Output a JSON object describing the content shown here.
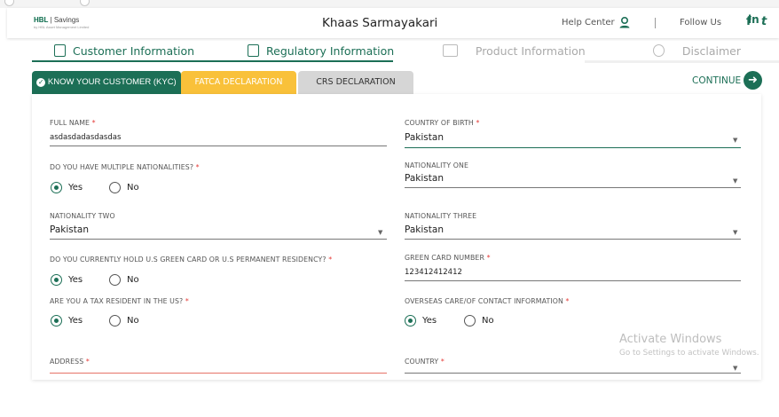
{
  "header": {
    "logo_brand": "HBL",
    "logo_product": "Savings",
    "logo_tagline": "by HBL Asset Management Limited",
    "title": "Khaas Sarmayakari",
    "help_label": "Help Center",
    "follow_label": "Follow Us",
    "social": [
      "f",
      "t",
      "in"
    ]
  },
  "tabs": [
    {
      "label": "Customer Information",
      "state": "active"
    },
    {
      "label": "Regulatory Information",
      "state": "active"
    },
    {
      "label": "Product Information",
      "state": "inactive"
    },
    {
      "label": "Disclaimer",
      "state": "inactive"
    }
  ],
  "subtabs": [
    {
      "label": "KNOW YOUR CUSTOMER (KYC)",
      "color": "#1c6f56"
    },
    {
      "label": "FATCA DECLARATION",
      "color": "#f9c13a"
    },
    {
      "label": "CRS DECLARATION",
      "color": "#d6d6d6"
    }
  ],
  "continue_label": "CONTINUE",
  "form": {
    "full_name": {
      "label": "FULL NAME",
      "value": "asdasdadasdasdas"
    },
    "country_of_birth": {
      "label": "COUNTRY OF BIRTH",
      "value": "Pakistan"
    },
    "multiple_nationalities": {
      "label": "DO YOU HAVE MULTIPLE NATIONALITIES?",
      "selected": "Yes"
    },
    "nationality_one": {
      "label": "NATIONALITY ONE",
      "value": "Pakistan"
    },
    "nationality_two": {
      "label": "NATIONALITY TWO",
      "value": "Pakistan"
    },
    "nationality_three": {
      "label": "NATIONALITY THREE",
      "value": "Pakistan"
    },
    "green_card": {
      "label": "DO YOU CURRENTLY HOLD U.S GREEN CARD OR U.S PERMANENT RESIDENCY?",
      "selected": "Yes"
    },
    "green_card_number": {
      "label": "GREEN CARD NUMBER",
      "value": "123412412412"
    },
    "tax_resident": {
      "label": "ARE YOU A TAX RESIDENT IN THE US?",
      "selected": "Yes"
    },
    "overseas_contact": {
      "label": "OVERSEAS CARE/OF CONTACT INFORMATION",
      "selected": "Yes"
    },
    "address": {
      "label": "ADDRESS",
      "value": ""
    },
    "country": {
      "label": "COUNTRY",
      "value": ""
    },
    "radio_yes": "Yes",
    "radio_no": "No",
    "required_mark": "*"
  },
  "watermark": {
    "title": "Activate Windows",
    "subtitle": "Go to Settings to activate Windows."
  },
  "colors": {
    "brand_green": "#1c6f56",
    "fatca_yellow": "#f9c13a",
    "inactive_gray": "#d6d6d6",
    "error_red": "#e57368"
  }
}
